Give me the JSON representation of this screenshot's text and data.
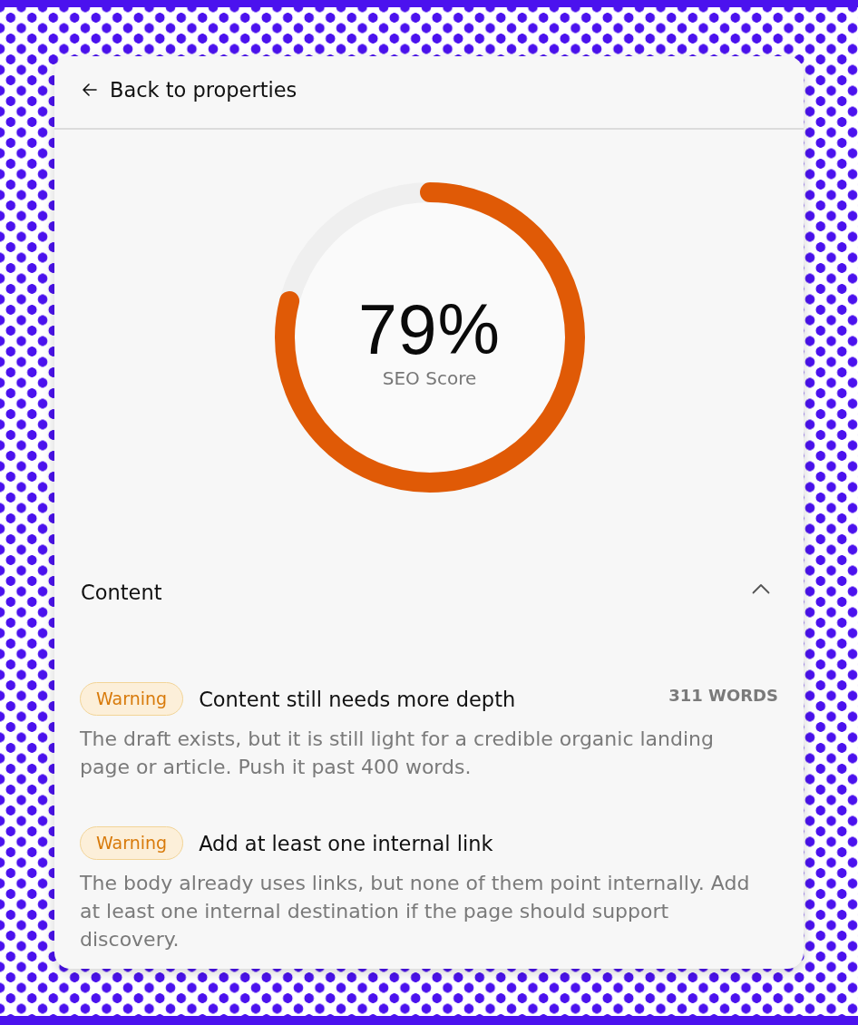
{
  "back_link": {
    "label": "Back to properties"
  },
  "score": {
    "value": "79%",
    "label": "SEO Score",
    "level": 0.79
  },
  "sections": [
    {
      "title": "Content",
      "expanded": true,
      "checks": [
        {
          "kind": "warning",
          "status": "Warning",
          "title": "Content still needs more depth",
          "meta": "311 WORDS",
          "description": "The draft exists, but it is still light for a credible organic landing page or article. Push it past 400 words."
        },
        {
          "kind": "warning",
          "status": "Warning",
          "title": "Add at least one internal link",
          "description": "The body already uses links, but none of them point internally. Add at least one internal destination if the page should support discovery."
        }
      ]
    }
  ]
}
